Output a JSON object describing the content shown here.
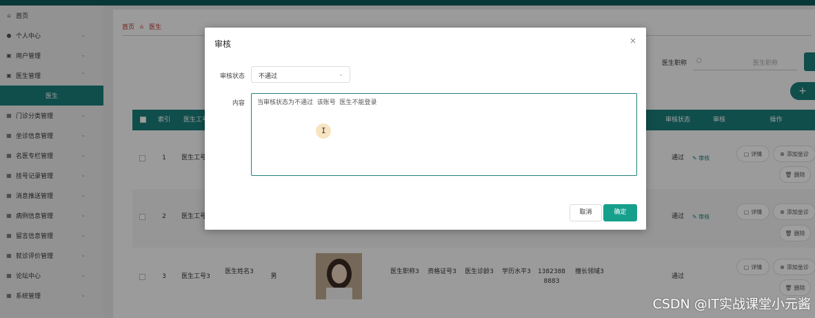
{
  "sidebar": {
    "items": [
      {
        "label": "首页",
        "icon": "home-icon",
        "arrow": false
      },
      {
        "label": "个人中心",
        "icon": "user-icon",
        "arrow": true
      },
      {
        "label": "用户管理",
        "icon": "doc-icon",
        "arrow": true
      },
      {
        "label": "医生管理",
        "icon": "doc-icon",
        "arrow": true
      },
      {
        "label": "医生",
        "icon": "",
        "arrow": false,
        "active": true
      },
      {
        "label": "门诊分类管理",
        "icon": "grid-icon",
        "arrow": true
      },
      {
        "label": "坐诊信息管理",
        "icon": "grid-icon",
        "arrow": true
      },
      {
        "label": "名医专栏管理",
        "icon": "grid-icon",
        "arrow": true
      },
      {
        "label": "挂号记录管理",
        "icon": "grid-icon",
        "arrow": true
      },
      {
        "label": "消息推送管理",
        "icon": "grid-icon",
        "arrow": true
      },
      {
        "label": "病例信息管理",
        "icon": "grid-icon",
        "arrow": true
      },
      {
        "label": "留言信息管理",
        "icon": "grid-icon",
        "arrow": true
      },
      {
        "label": "就诊评价管理",
        "icon": "grid-icon",
        "arrow": true
      },
      {
        "label": "论坛中心",
        "icon": "grid-icon",
        "arrow": true
      },
      {
        "label": "系统管理",
        "icon": "grid-icon",
        "arrow": true
      }
    ]
  },
  "breadcrumb": {
    "home": "首页",
    "current": "医生"
  },
  "search": {
    "label": "医生职称",
    "placeholder": "医生职称"
  },
  "add_button": "+",
  "table": {
    "headers": [
      "索引",
      "医生工号",
      "审核状态",
      "审核",
      "操作"
    ],
    "rows": [
      {
        "index": "1",
        "doc_no": "医生工号1",
        "status": "通过",
        "audit": "审核",
        "name": "",
        "gender": "",
        "title": "",
        "cert": "",
        "fee": "",
        "edu": "",
        "phone": "",
        "specialty": ""
      },
      {
        "index": "2",
        "doc_no": "医生工号2",
        "status": "通过",
        "audit": "审核",
        "name": "",
        "gender": "",
        "title": "",
        "cert": "",
        "fee": "",
        "edu": "",
        "phone": "",
        "specialty": ""
      },
      {
        "index": "3",
        "doc_no": "医生工号3",
        "status": "通过",
        "audit": "",
        "name": "医生姓名3",
        "gender": "男",
        "title": "医生职称3",
        "cert": "资格证号3",
        "fee": "医生诊龄3",
        "edu": "学历水平3",
        "phone": "13823888883",
        "specialty": "擅长领域3"
      }
    ],
    "ops": {
      "detail": "详情",
      "add_clinic": "添加坐诊",
      "delete": "删除"
    }
  },
  "modal": {
    "title": "审核",
    "close": "×",
    "status_label": "审核状态",
    "status_value": "不通过",
    "content_label": "内容",
    "content_value": "当审核状态为不通过  该账号  医生不能登录",
    "cancel": "取消",
    "ok": "确定"
  },
  "watermark": "CSDN @IT实战课堂小元酱",
  "colors": {
    "primary": "#1a7f7b",
    "ok_button": "#16a08c",
    "topbar": "#0f5b57"
  }
}
